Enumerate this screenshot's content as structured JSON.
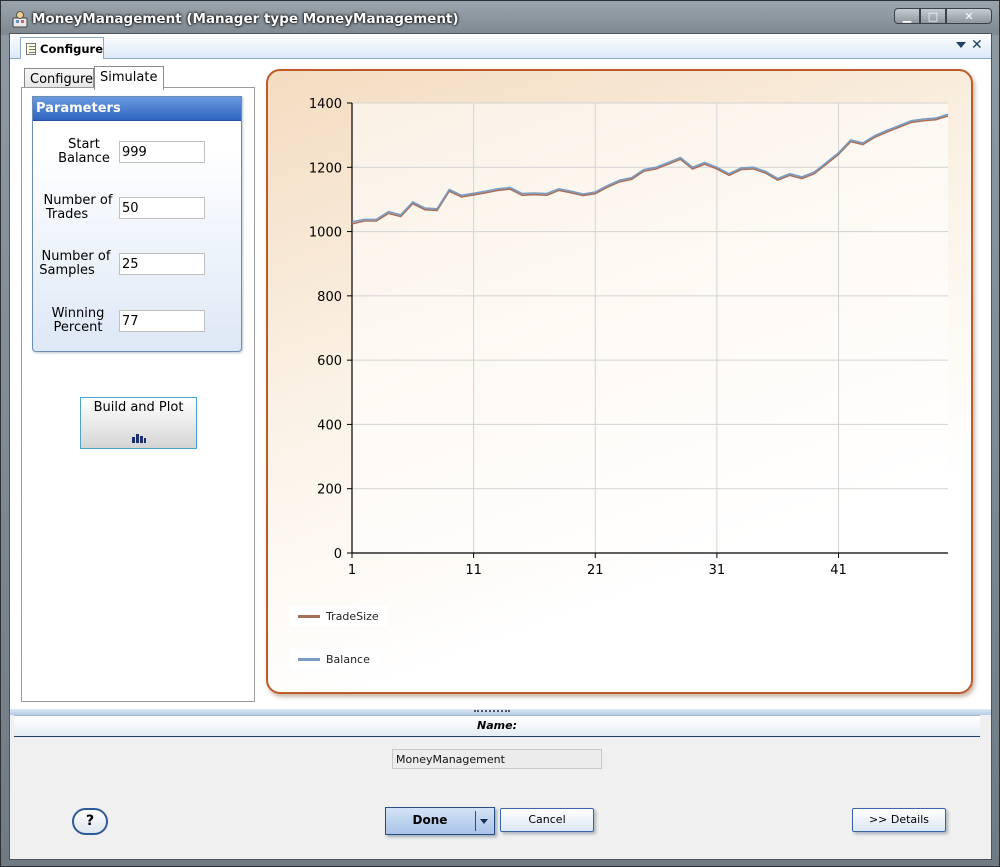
{
  "window": {
    "title": "MoneyManagement (Manager type MoneyManagement)",
    "controls": [
      "▁",
      "□",
      "✕"
    ]
  },
  "doc_tab": {
    "label": "Configure"
  },
  "inner_tabs": [
    {
      "label": "Configure",
      "active": false
    },
    {
      "label": "Simulate",
      "active": true
    }
  ],
  "parameters": {
    "header": "Parameters",
    "fields": [
      {
        "label_line1": "Start",
        "label_line2": "Balance",
        "value": "999"
      },
      {
        "label_line1": "Number of",
        "label_line2": "Trades",
        "value": "50"
      },
      {
        "label_line1": "Number of",
        "label_line2": "Samples",
        "value": "25"
      },
      {
        "label_line1": "Winning",
        "label_line2": "Percent",
        "value": "77"
      }
    ]
  },
  "build_button": {
    "label": "Build and Plot",
    "icon": "bar-chart-icon"
  },
  "chart_data": {
    "type": "line",
    "xlabel": "",
    "ylabel": "",
    "ylim": [
      0,
      1400
    ],
    "xlim": [
      1,
      50
    ],
    "yticks": [
      0,
      200,
      400,
      600,
      800,
      1000,
      1200,
      1400
    ],
    "xticks": [
      1,
      11,
      21,
      31,
      41
    ],
    "grid": true,
    "legend_position": "bottom-left",
    "series": [
      {
        "name": "TradeSize",
        "color": "#a8705a",
        "x": [
          1,
          2,
          3,
          4,
          5,
          6,
          7,
          8,
          9,
          10,
          11,
          12,
          13,
          14,
          15,
          16,
          17,
          18,
          19,
          20,
          21,
          22,
          23,
          24,
          25,
          26,
          27,
          28,
          29,
          30,
          31,
          32,
          33,
          34,
          35,
          36,
          37,
          38,
          39,
          40,
          41,
          42,
          43,
          44,
          45,
          46,
          47,
          48,
          49,
          50
        ],
        "y": [
          1024,
          1033,
          1033,
          1057,
          1047,
          1087,
          1068,
          1066,
          1126,
          1108,
          1114,
          1121,
          1128,
          1132,
          1113,
          1115,
          1113,
          1128,
          1121,
          1112,
          1118,
          1138,
          1155,
          1163,
          1188,
          1195,
          1210,
          1225,
          1195,
          1210,
          1195,
          1175,
          1193,
          1195,
          1182,
          1160,
          1175,
          1165,
          1180,
          1210,
          1240,
          1280,
          1271,
          1294,
          1310,
          1325,
          1340,
          1345,
          1348,
          1360
        ]
      },
      {
        "name": "Balance",
        "color": "#7a9cc4",
        "x": [
          1,
          2,
          3,
          4,
          5,
          6,
          7,
          8,
          9,
          10,
          11,
          12,
          13,
          14,
          15,
          16,
          17,
          18,
          19,
          20,
          21,
          22,
          23,
          24,
          25,
          26,
          27,
          28,
          29,
          30,
          31,
          32,
          33,
          34,
          35,
          36,
          37,
          38,
          39,
          40,
          41,
          42,
          43,
          44,
          45,
          46,
          47,
          48,
          49,
          50
        ],
        "y": [
          1030,
          1038,
          1038,
          1062,
          1052,
          1092,
          1073,
          1071,
          1131,
          1113,
          1119,
          1126,
          1133,
          1137,
          1118,
          1120,
          1118,
          1133,
          1126,
          1117,
          1123,
          1143,
          1160,
          1168,
          1193,
          1200,
          1215,
          1230,
          1200,
          1215,
          1200,
          1180,
          1198,
          1200,
          1187,
          1165,
          1180,
          1170,
          1185,
          1215,
          1245,
          1285,
          1276,
          1299,
          1315,
          1330,
          1345,
          1350,
          1353,
          1365
        ]
      }
    ]
  },
  "footer": {
    "name_header": "Name:",
    "name_value": "MoneyManagement",
    "help_label": "?",
    "done_label": "Done",
    "cancel_label": "Cancel",
    "details_label": ">> Details"
  }
}
